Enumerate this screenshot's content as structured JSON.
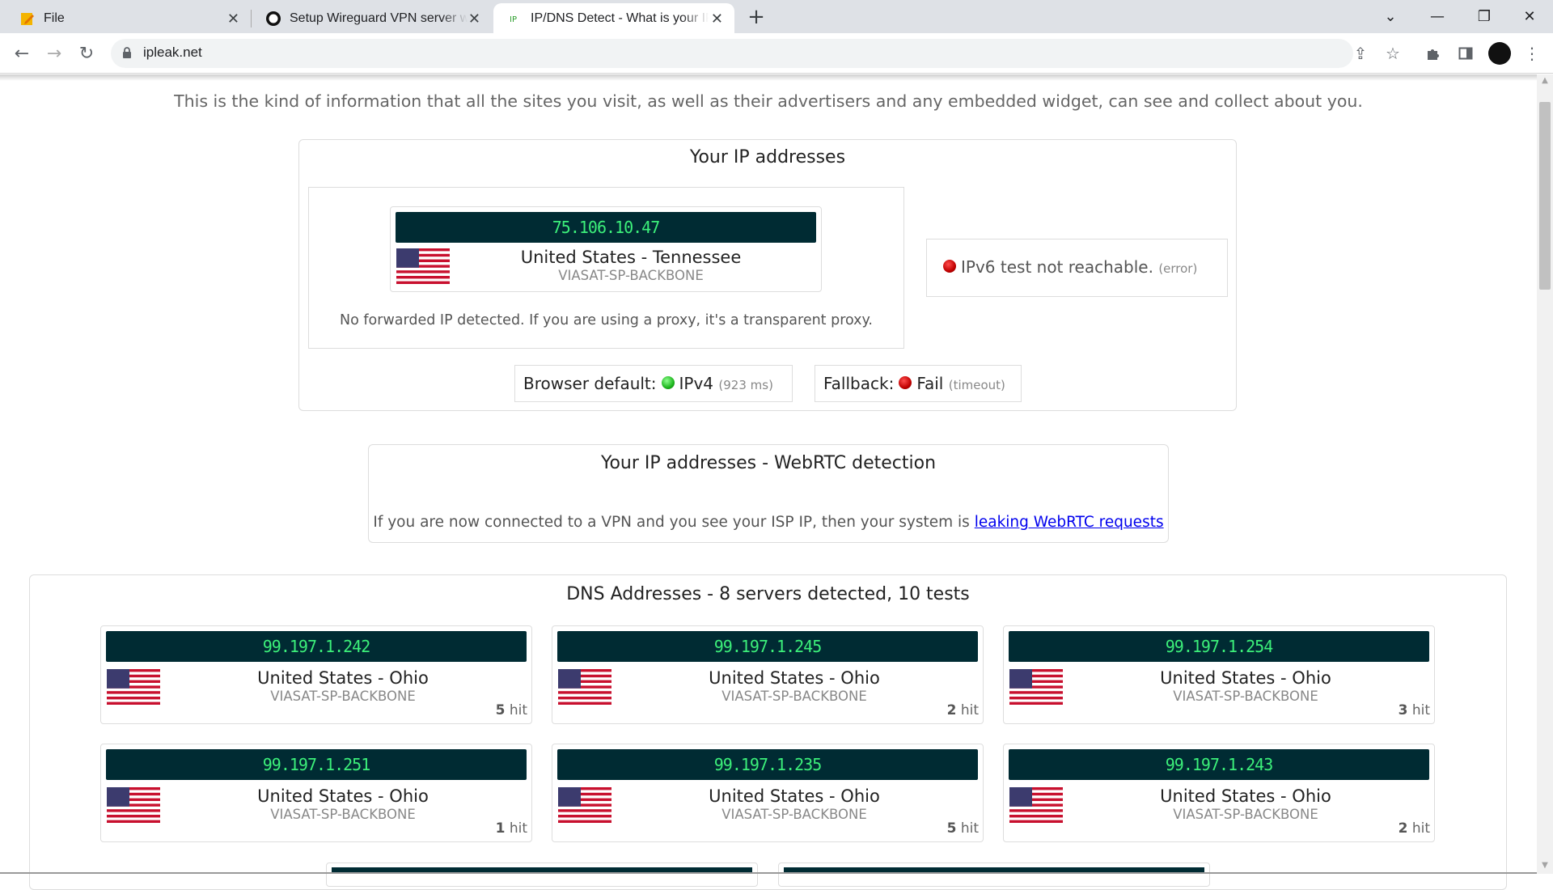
{
  "browser": {
    "tabs": [
      {
        "label": "File",
        "icon": "note-pencil-icon"
      },
      {
        "label": "Setup Wireguard VPN server with",
        "icon": "site-circle-icon"
      },
      {
        "label": "IP/DNS Detect - What is your IP,",
        "icon": "ipleak-icon",
        "active": true
      }
    ],
    "url": "ipleak.net"
  },
  "intro": "This is the kind of information that all the sites you visit, as well as their advertisers and any embedded widget, can see and collect about you.",
  "ip_section": {
    "title": "Your IP addresses",
    "ip": "75.106.10.47",
    "location": "United States - Tennessee",
    "isp": "VIASAT-SP-BACKBONE",
    "forwarded_note": "No forwarded IP detected. If you are using a proxy, it's a transparent proxy.",
    "ipv6_text": "IPv6 test not reachable.",
    "ipv6_status": "(error)",
    "browser_default_label": "Browser default:",
    "browser_default_value": "IPv4",
    "browser_default_time": "(923 ms)",
    "fallback_label": "Fallback:",
    "fallback_value": "Fail",
    "fallback_status": "(timeout)"
  },
  "webrtc": {
    "title": "Your IP addresses - WebRTC detection",
    "note": "If you are now connected to a VPN and you see your ISP IP, then your system is",
    "link": "leaking WebRTC requests"
  },
  "dns": {
    "title": "DNS Addresses - 8 servers detected, 10 tests",
    "servers": [
      {
        "ip": "99.197.1.242",
        "location": "United States - Ohio",
        "isp": "VIASAT-SP-BACKBONE",
        "hits": "5",
        "hit_label": "hit"
      },
      {
        "ip": "99.197.1.245",
        "location": "United States - Ohio",
        "isp": "VIASAT-SP-BACKBONE",
        "hits": "2",
        "hit_label": "hit"
      },
      {
        "ip": "99.197.1.254",
        "location": "United States - Ohio",
        "isp": "VIASAT-SP-BACKBONE",
        "hits": "3",
        "hit_label": "hit"
      },
      {
        "ip": "99.197.1.251",
        "location": "United States - Ohio",
        "isp": "VIASAT-SP-BACKBONE",
        "hits": "1",
        "hit_label": "hit"
      },
      {
        "ip": "99.197.1.235",
        "location": "United States - Ohio",
        "isp": "VIASAT-SP-BACKBONE",
        "hits": "5",
        "hit_label": "hit"
      },
      {
        "ip": "99.197.1.243",
        "location": "United States - Ohio",
        "isp": "VIASAT-SP-BACKBONE",
        "hits": "2",
        "hit_label": "hit"
      }
    ]
  },
  "colors": {
    "ip_bar_bg": "#002b33",
    "ip_text": "#3cf07a",
    "ok": "#1db51d",
    "error": "#c00000"
  }
}
